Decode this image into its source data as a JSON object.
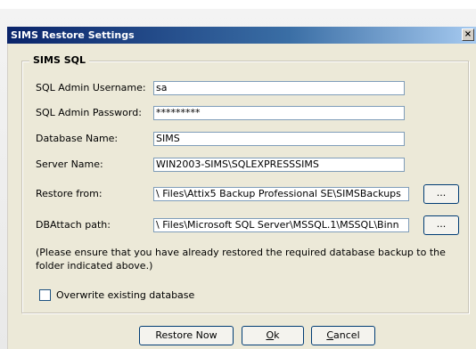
{
  "window": {
    "title": "SIMS Restore Settings",
    "close_glyph": "×"
  },
  "group": {
    "title": "SIMS SQL"
  },
  "fields": {
    "username": {
      "label": "SQL Admin Username:",
      "value": "sa"
    },
    "password": {
      "label": "SQL Admin Password:",
      "value": "*********"
    },
    "database": {
      "label": "Database Name:",
      "value": "SIMS"
    },
    "server": {
      "label": "Server Name:",
      "value": "WIN2003-SIMS\\SQLEXPRESSSIMS"
    },
    "restore_from": {
      "label": "Restore from:",
      "value": "\\ Files\\Attix5 Backup Professional SE\\SIMSBackups"
    },
    "dbattach": {
      "label": "DBAttach path:",
      "value": "\\ Files\\Microsoft SQL Server\\MSSQL.1\\MSSQL\\Binn"
    }
  },
  "browse_label": "...",
  "note": "(Please ensure that you have already restored the required database backup to the folder indicated above.)",
  "overwrite": {
    "label": "Overwrite existing database",
    "checked": false
  },
  "buttons": {
    "restore_now": "Restore Now",
    "ok_mnemonic": "O",
    "ok_rest": "k",
    "cancel_mnemonic": "C",
    "cancel_rest": "ancel"
  }
}
